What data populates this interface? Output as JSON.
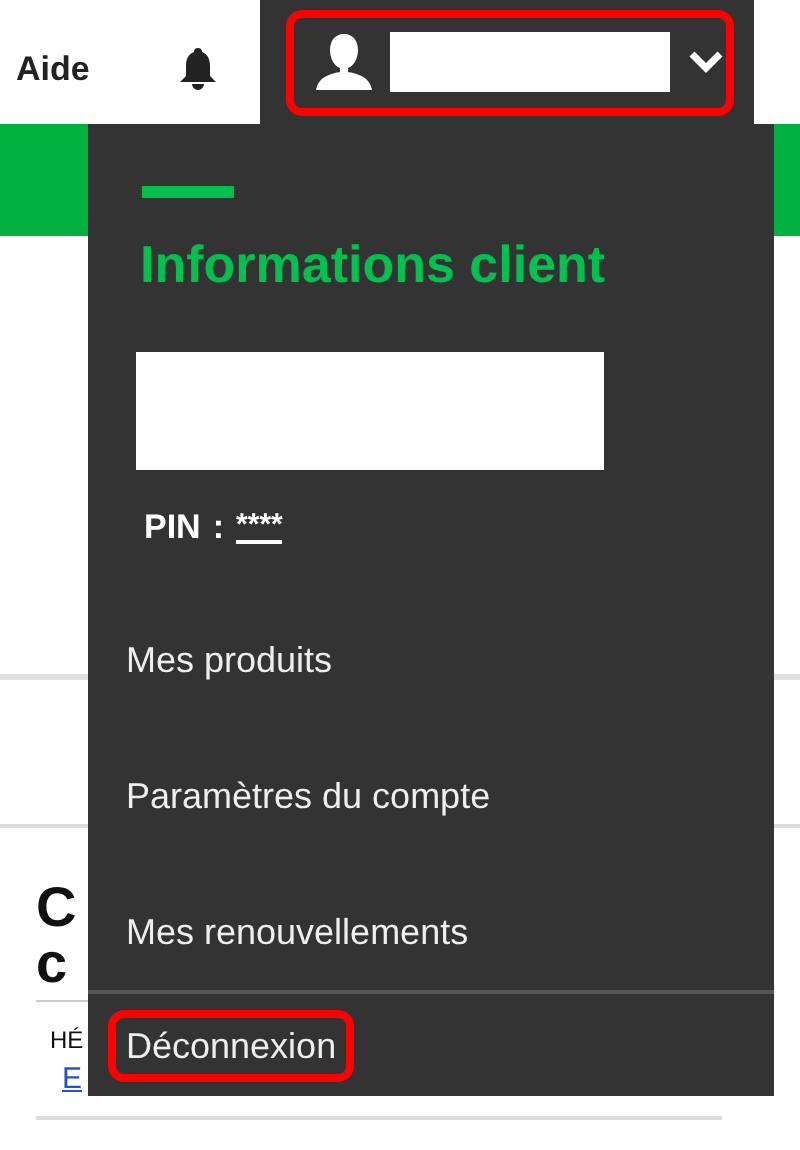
{
  "top_bar": {
    "help_link": "Aide",
    "user_button": {
      "expanded": true,
      "highlighted": true
    }
  },
  "page": {
    "heading_lines": [
      "C",
      "c"
    ],
    "label": "HÉ",
    "link": "E"
  },
  "dropdown": {
    "title": "Informations client",
    "pin_label": "PIN",
    "pin_separator": ":",
    "pin_value": "****",
    "items": [
      {
        "label": "Mes produits",
        "highlighted": false,
        "kind": "link"
      },
      {
        "label": "Paramètres du compte",
        "highlighted": false,
        "kind": "link"
      },
      {
        "label": "Mes renouvellements",
        "highlighted": false,
        "kind": "link"
      },
      {
        "label": "Déconnexion",
        "highlighted": true,
        "kind": "logout"
      }
    ]
  }
}
